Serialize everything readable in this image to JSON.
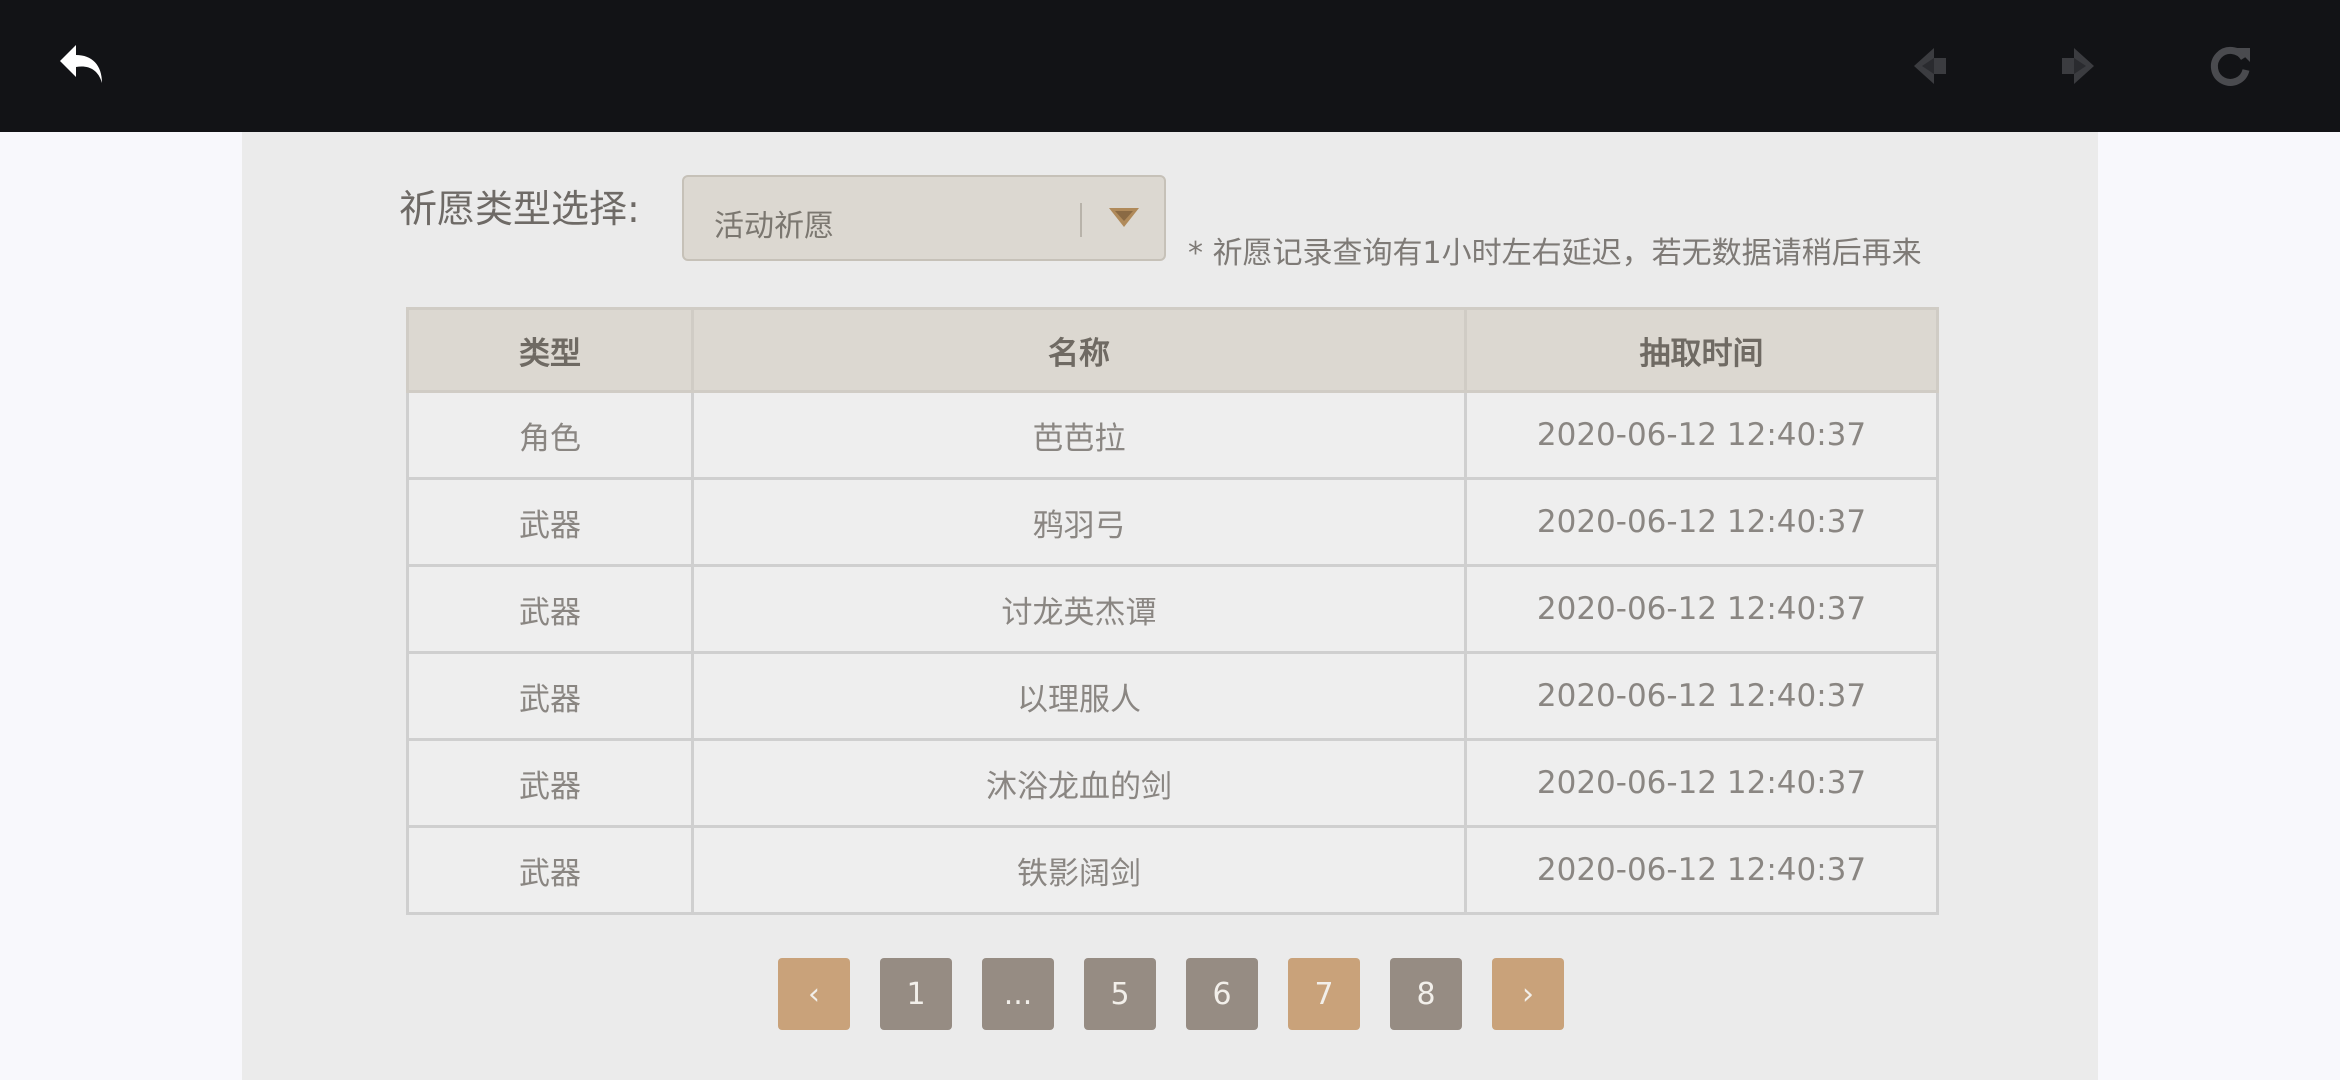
{
  "topbar": {
    "back_icon": "back-arrow-icon",
    "prev_icon": "nav-prev-icon",
    "next_icon": "nav-next-icon",
    "refresh_icon": "refresh-icon"
  },
  "filter": {
    "label": "祈愿类型选择:",
    "selected": "活动祈愿",
    "notice": "* 祈愿记录查询有1小时左右延迟，若无数据请稍后再来"
  },
  "table": {
    "headers": [
      "类型",
      "名称",
      "抽取时间"
    ],
    "rows": [
      [
        "角色",
        "芭芭拉",
        "2020-06-12 12:40:37"
      ],
      [
        "武器",
        "鸦羽弓",
        "2020-06-12 12:40:37"
      ],
      [
        "武器",
        "讨龙英杰谭",
        "2020-06-12 12:40:37"
      ],
      [
        "武器",
        "以理服人",
        "2020-06-12 12:40:37"
      ],
      [
        "武器",
        "沐浴龙血的剑",
        "2020-06-12 12:40:37"
      ],
      [
        "武器",
        "铁影阔剑",
        "2020-06-12 12:40:37"
      ]
    ]
  },
  "pagination": {
    "prev": "‹",
    "next": "›",
    "pages": [
      "1",
      "...",
      "5",
      "6",
      "7",
      "8"
    ],
    "current": "7"
  },
  "colors": {
    "topbar": "#121316",
    "accent": "#c9a27a",
    "page_gray": "#968c83"
  }
}
